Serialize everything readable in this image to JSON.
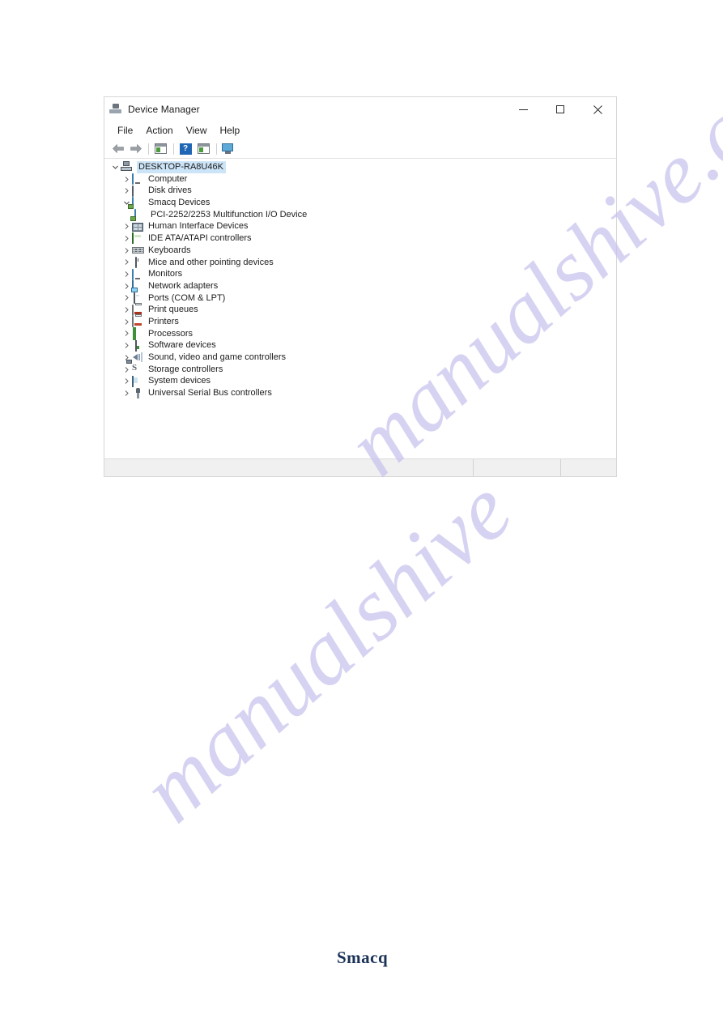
{
  "window": {
    "title": "Device Manager",
    "title_icon": "device-manager-icon",
    "caption": {
      "minimize": "minimize-icon",
      "maximize": "maximize-icon",
      "close": "close-icon"
    }
  },
  "menubar": {
    "items": [
      {
        "label": "File"
      },
      {
        "label": "Action"
      },
      {
        "label": "View"
      },
      {
        "label": "Help"
      }
    ]
  },
  "toolbar": {
    "buttons": [
      {
        "name": "back-arrow-icon"
      },
      {
        "name": "forward-arrow-icon"
      },
      {
        "name": "properties-icon"
      },
      {
        "name": "help-icon"
      },
      {
        "name": "scan-hardware-changes-icon"
      },
      {
        "name": "update-driver-icon"
      }
    ]
  },
  "tree": {
    "root": {
      "label": "DESKTOP-RA8U46K",
      "icon": "computer-root-icon",
      "expanded": true,
      "selected": true
    },
    "items": [
      {
        "label": "Computer",
        "icon": "monitor-icon",
        "depth": 1,
        "expanded": false
      },
      {
        "label": "Disk drives",
        "icon": "disk-drive-icon",
        "depth": 1,
        "expanded": false
      },
      {
        "label": "Smacq Devices",
        "icon": "smacq-device-icon",
        "depth": 1,
        "expanded": true
      },
      {
        "label": "PCI-2252/2253 Multifunction I/O Device",
        "icon": "pci-device-icon",
        "depth": 2,
        "expanded": null
      },
      {
        "label": "Human Interface Devices",
        "icon": "hid-icon",
        "depth": 1,
        "expanded": false
      },
      {
        "label": "IDE ATA/ATAPI controllers",
        "icon": "ide-controller-icon",
        "depth": 1,
        "expanded": false
      },
      {
        "label": "Keyboards",
        "icon": "keyboard-icon",
        "depth": 1,
        "expanded": false
      },
      {
        "label": "Mice and other pointing devices",
        "icon": "mouse-icon",
        "depth": 1,
        "expanded": false
      },
      {
        "label": "Monitors",
        "icon": "monitor-icon",
        "depth": 1,
        "expanded": false
      },
      {
        "label": "Network adapters",
        "icon": "network-adapter-icon",
        "depth": 1,
        "expanded": false
      },
      {
        "label": "Ports (COM & LPT)",
        "icon": "port-icon",
        "depth": 1,
        "expanded": false
      },
      {
        "label": "Print queues",
        "icon": "print-queue-icon",
        "depth": 1,
        "expanded": false
      },
      {
        "label": "Printers",
        "icon": "printer-icon",
        "depth": 1,
        "expanded": false
      },
      {
        "label": "Processors",
        "icon": "processor-icon",
        "depth": 1,
        "expanded": false
      },
      {
        "label": "Software devices",
        "icon": "software-device-icon",
        "depth": 1,
        "expanded": false
      },
      {
        "label": "Sound, video and game controllers",
        "icon": "sound-controller-icon",
        "depth": 1,
        "expanded": false
      },
      {
        "label": "Storage controllers",
        "icon": "storage-controller-icon",
        "depth": 1,
        "expanded": false
      },
      {
        "label": "System devices",
        "icon": "system-device-icon",
        "depth": 1,
        "expanded": false
      },
      {
        "label": "Universal Serial Bus controllers",
        "icon": "usb-controller-icon",
        "depth": 1,
        "expanded": false
      }
    ]
  },
  "statusbar": {
    "segments": [
      "",
      "",
      ""
    ]
  },
  "footer": {
    "logo_text": "Smacq"
  },
  "watermark": {
    "line1": "manualshive.com",
    "line2": "manualshive",
    "color": "#c7c3ee"
  },
  "colors": {
    "selection": "#cce4f7",
    "accent": "#1f66b5",
    "logo": "#1b3358",
    "status_bg": "#f0f0f0"
  }
}
